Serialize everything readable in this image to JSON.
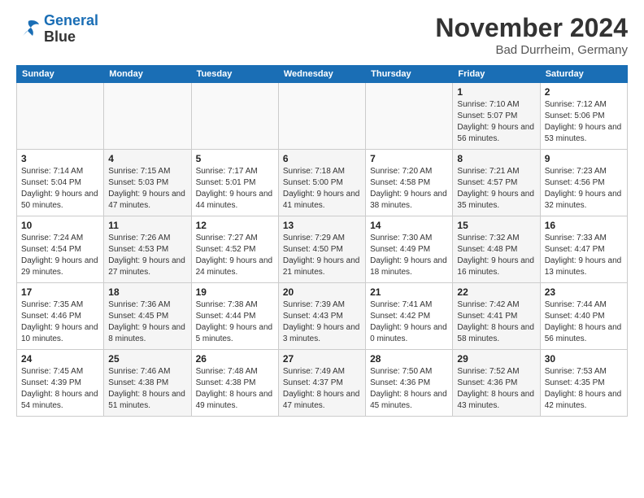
{
  "header": {
    "logo": {
      "line1": "General",
      "line2": "Blue"
    },
    "month": "November 2024",
    "location": "Bad Durrheim, Germany"
  },
  "days_of_week": [
    "Sunday",
    "Monday",
    "Tuesday",
    "Wednesday",
    "Thursday",
    "Friday",
    "Saturday"
  ],
  "weeks": [
    {
      "days": [
        {
          "date": "",
          "info": ""
        },
        {
          "date": "",
          "info": ""
        },
        {
          "date": "",
          "info": ""
        },
        {
          "date": "",
          "info": ""
        },
        {
          "date": "",
          "info": ""
        },
        {
          "date": "1",
          "info": "Sunrise: 7:10 AM\nSunset: 5:07 PM\nDaylight: 9 hours and 56 minutes."
        },
        {
          "date": "2",
          "info": "Sunrise: 7:12 AM\nSunset: 5:06 PM\nDaylight: 9 hours and 53 minutes."
        }
      ]
    },
    {
      "days": [
        {
          "date": "3",
          "info": "Sunrise: 7:14 AM\nSunset: 5:04 PM\nDaylight: 9 hours and 50 minutes."
        },
        {
          "date": "4",
          "info": "Sunrise: 7:15 AM\nSunset: 5:03 PM\nDaylight: 9 hours and 47 minutes."
        },
        {
          "date": "5",
          "info": "Sunrise: 7:17 AM\nSunset: 5:01 PM\nDaylight: 9 hours and 44 minutes."
        },
        {
          "date": "6",
          "info": "Sunrise: 7:18 AM\nSunset: 5:00 PM\nDaylight: 9 hours and 41 minutes."
        },
        {
          "date": "7",
          "info": "Sunrise: 7:20 AM\nSunset: 4:58 PM\nDaylight: 9 hours and 38 minutes."
        },
        {
          "date": "8",
          "info": "Sunrise: 7:21 AM\nSunset: 4:57 PM\nDaylight: 9 hours and 35 minutes."
        },
        {
          "date": "9",
          "info": "Sunrise: 7:23 AM\nSunset: 4:56 PM\nDaylight: 9 hours and 32 minutes."
        }
      ]
    },
    {
      "days": [
        {
          "date": "10",
          "info": "Sunrise: 7:24 AM\nSunset: 4:54 PM\nDaylight: 9 hours and 29 minutes."
        },
        {
          "date": "11",
          "info": "Sunrise: 7:26 AM\nSunset: 4:53 PM\nDaylight: 9 hours and 27 minutes."
        },
        {
          "date": "12",
          "info": "Sunrise: 7:27 AM\nSunset: 4:52 PM\nDaylight: 9 hours and 24 minutes."
        },
        {
          "date": "13",
          "info": "Sunrise: 7:29 AM\nSunset: 4:50 PM\nDaylight: 9 hours and 21 minutes."
        },
        {
          "date": "14",
          "info": "Sunrise: 7:30 AM\nSunset: 4:49 PM\nDaylight: 9 hours and 18 minutes."
        },
        {
          "date": "15",
          "info": "Sunrise: 7:32 AM\nSunset: 4:48 PM\nDaylight: 9 hours and 16 minutes."
        },
        {
          "date": "16",
          "info": "Sunrise: 7:33 AM\nSunset: 4:47 PM\nDaylight: 9 hours and 13 minutes."
        }
      ]
    },
    {
      "days": [
        {
          "date": "17",
          "info": "Sunrise: 7:35 AM\nSunset: 4:46 PM\nDaylight: 9 hours and 10 minutes."
        },
        {
          "date": "18",
          "info": "Sunrise: 7:36 AM\nSunset: 4:45 PM\nDaylight: 9 hours and 8 minutes."
        },
        {
          "date": "19",
          "info": "Sunrise: 7:38 AM\nSunset: 4:44 PM\nDaylight: 9 hours and 5 minutes."
        },
        {
          "date": "20",
          "info": "Sunrise: 7:39 AM\nSunset: 4:43 PM\nDaylight: 9 hours and 3 minutes."
        },
        {
          "date": "21",
          "info": "Sunrise: 7:41 AM\nSunset: 4:42 PM\nDaylight: 9 hours and 0 minutes."
        },
        {
          "date": "22",
          "info": "Sunrise: 7:42 AM\nSunset: 4:41 PM\nDaylight: 8 hours and 58 minutes."
        },
        {
          "date": "23",
          "info": "Sunrise: 7:44 AM\nSunset: 4:40 PM\nDaylight: 8 hours and 56 minutes."
        }
      ]
    },
    {
      "days": [
        {
          "date": "24",
          "info": "Sunrise: 7:45 AM\nSunset: 4:39 PM\nDaylight: 8 hours and 54 minutes."
        },
        {
          "date": "25",
          "info": "Sunrise: 7:46 AM\nSunset: 4:38 PM\nDaylight: 8 hours and 51 minutes."
        },
        {
          "date": "26",
          "info": "Sunrise: 7:48 AM\nSunset: 4:38 PM\nDaylight: 8 hours and 49 minutes."
        },
        {
          "date": "27",
          "info": "Sunrise: 7:49 AM\nSunset: 4:37 PM\nDaylight: 8 hours and 47 minutes."
        },
        {
          "date": "28",
          "info": "Sunrise: 7:50 AM\nSunset: 4:36 PM\nDaylight: 8 hours and 45 minutes."
        },
        {
          "date": "29",
          "info": "Sunrise: 7:52 AM\nSunset: 4:36 PM\nDaylight: 8 hours and 43 minutes."
        },
        {
          "date": "30",
          "info": "Sunrise: 7:53 AM\nSunset: 4:35 PM\nDaylight: 8 hours and 42 minutes."
        }
      ]
    }
  ]
}
